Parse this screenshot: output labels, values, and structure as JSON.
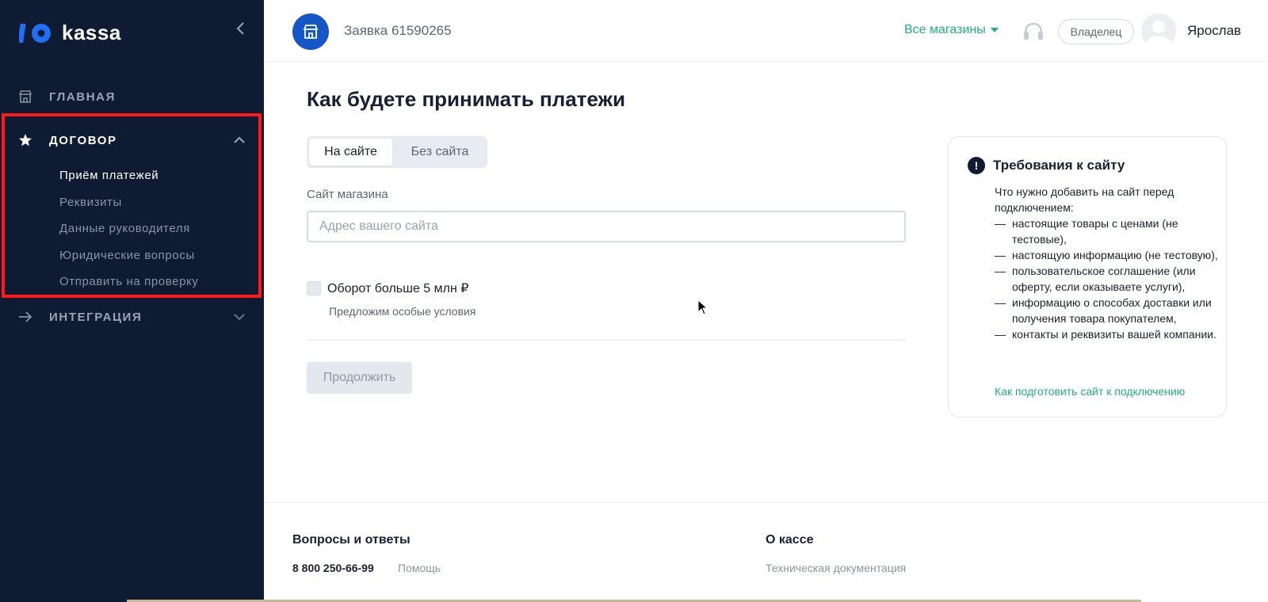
{
  "brand": {
    "logo_text": "kassa"
  },
  "sidebar": {
    "items": [
      {
        "label": "ГЛАВНАЯ",
        "icon": "store-icon"
      },
      {
        "label": "ДОГОВОР",
        "icon": "star-icon",
        "expanded": true
      },
      {
        "label": "ИНТЕГРАЦИЯ",
        "icon": "arrow-right-icon",
        "expanded": false
      }
    ],
    "contract_subitems": [
      {
        "label": "Приём платежей",
        "active": true
      },
      {
        "label": "Реквизиты"
      },
      {
        "label": "Данные руководителя"
      },
      {
        "label": "Юридические вопросы"
      },
      {
        "label": "Отправить на проверку"
      }
    ]
  },
  "header": {
    "request_title": "Заявка 61590265",
    "stores_dropdown": "Все магазины",
    "role_label": "Владелец",
    "user_name": "Ярослав"
  },
  "main": {
    "title": "Как будете принимать платежи",
    "tabs": [
      {
        "label": "На сайте",
        "selected": true
      },
      {
        "label": "Без сайта",
        "selected": false
      }
    ],
    "site_field": {
      "label": "Сайт магазина",
      "placeholder": "Адрес вашего сайта",
      "value": ""
    },
    "turnover_checkbox": {
      "label": "Оборот больше 5 млн ₽",
      "hint": "Предложим особые условия",
      "checked": false
    },
    "continue_label": "Продолжить"
  },
  "requirements": {
    "title": "Требования к сайту",
    "intro": "Что нужно добавить на сайт перед подключением:",
    "items": [
      "настоящие товары с ценами (не тестовые),",
      "настоящую информацию (не тестовую),",
      "пользовательское соглашение (или оферту, если оказываете услуги),",
      "информацию о способах доставки или получения товара покупателем,",
      "контакты и реквизиты вашей компании."
    ],
    "link": "Как подготовить сайт к подключению"
  },
  "footer": {
    "faq_heading": "Вопросы и ответы",
    "phone": "8 800 250-66-99",
    "help_link": "Помощь",
    "about_heading": "О кассе",
    "docs_link": "Техническая документация"
  },
  "colors": {
    "sidebar_bg": "#0f1a33",
    "accent_green": "#1db37a",
    "brand_blue": "#1557c7",
    "highlight_red": "#ff1a1a"
  }
}
